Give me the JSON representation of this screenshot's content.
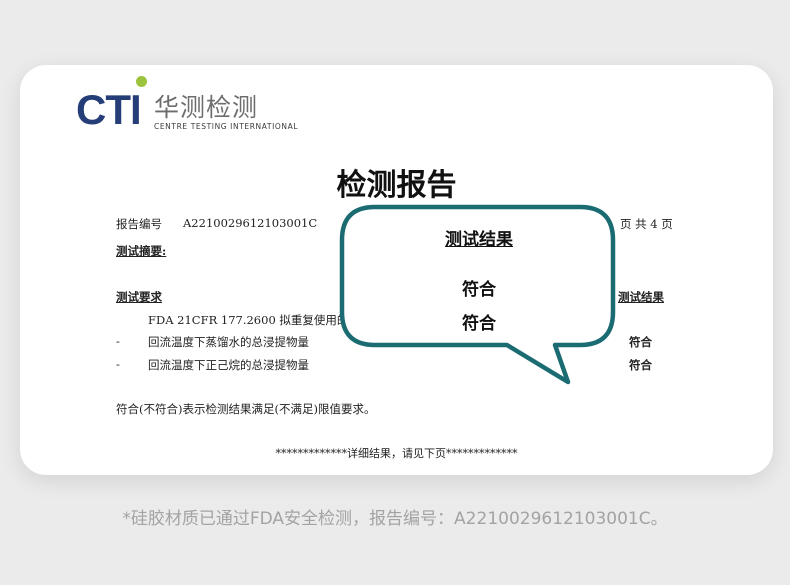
{
  "logo": {
    "brand": "CTI",
    "cn_name": "华测检测",
    "en_name": "CENTRE TESTING INTERNATIONAL",
    "brand_color": "#263e78",
    "dot_color": "#9cc33c"
  },
  "report": {
    "title": "检测报告",
    "report_no_label": "报告编号",
    "report_no": "A2210029612103001C",
    "page_info": "页 共 4 页",
    "summary_label": "测试摘要:",
    "requirements_label": "测试要求",
    "results_label": "测试结果",
    "requirement_main": "FDA 21CFR 177.2600  拟重复使用的",
    "items": [
      {
        "dash": "-",
        "text": "回流温度下蒸馏水的总浸提物量",
        "result": "符合"
      },
      {
        "dash": "-",
        "text": "回流温度下正己烷的总浸提物量",
        "result": "符合"
      }
    ],
    "note": "符合(不符合)表示检测结果满足(不满足)限值要求。",
    "footer": "*************详细结果，请见下页*************"
  },
  "bubble": {
    "heading": "测试结果",
    "line1": "符合",
    "line2": "符合",
    "border_color": "#1b6b73"
  },
  "caption": "*硅胶材质已通过FDA安全检测，报告编号：A2210029612103001C。"
}
